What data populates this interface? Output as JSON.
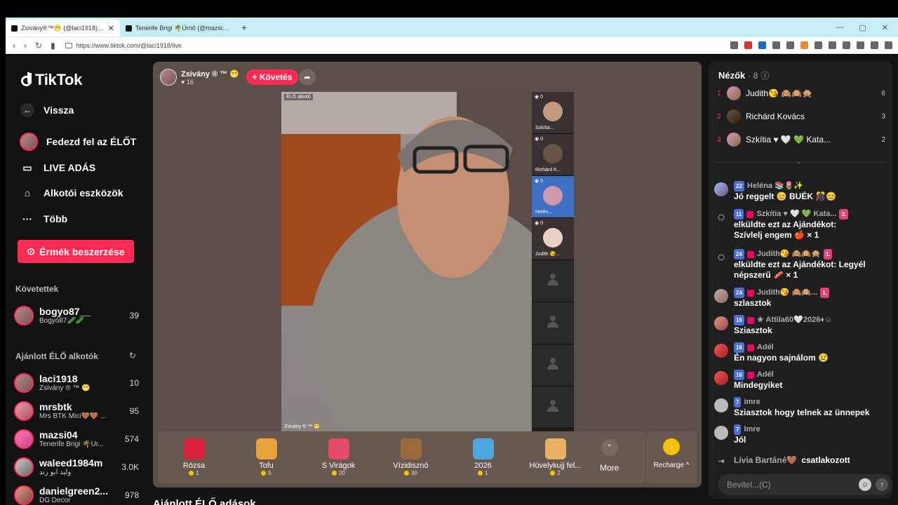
{
  "browser": {
    "tabs": [
      {
        "title": "Zsivány®™😁 (@laci1918) É...",
        "close": "✕"
      },
      {
        "title": "Tenerife Brigi 🌴Úrnő (@mazsi04) Él..."
      }
    ],
    "new_tab": "+",
    "url": "https://www.tiktok.com/@laci1918/live"
  },
  "sidebar": {
    "logo": "TikTok",
    "back": "Vissza",
    "items": [
      "Fedezd fel az ÉLŐT",
      "LIVE ADÁS",
      "Alkotói eszközök",
      "Több"
    ],
    "coins_button": "Érmék beszerzése",
    "following_heading": "Követettek",
    "following": [
      {
        "name": "bogyo87__",
        "sub": "Bogyó87🥒🥒",
        "count": "39"
      }
    ],
    "recommended_heading": "Ajánlott ÉLŐ alkotók",
    "recommended": [
      {
        "name": "laci1918",
        "sub": "Zsivány ® ™ 😁",
        "count": "10"
      },
      {
        "name": "mrsbtk",
        "sub": "Mrs BTK Mici🤎🤎 ...",
        "count": "95"
      },
      {
        "name": "mazsi04",
        "sub": "Tenerife Brigi 🌴Úr...",
        "count": "574"
      },
      {
        "name": "waleed1984m",
        "sub": "وليد ابو رند",
        "count": "3.0K"
      },
      {
        "name": "danielgreen2...",
        "sub": "DG Decor",
        "count": "978"
      }
    ]
  },
  "bottom_heading": "Ajánlott ÉLŐ adások",
  "player": {
    "host_name": "Zsivány ® ™ 😁",
    "likes": "♥ 16",
    "follow": "+ Követés",
    "video_tag": "ÉLŐ alkotó",
    "video_caption": "Zsivány ® ™ 😁",
    "guests": [
      {
        "viewers": "0",
        "name": "Szkítia..."
      },
      {
        "viewers": "0",
        "name": "Richárd K..."
      },
      {
        "viewers": "0",
        "name": "Helén..."
      },
      {
        "viewers": "0",
        "name": "Judith 😘..."
      }
    ],
    "gifts": [
      {
        "name": "Rózsa",
        "cost": "1",
        "color": "#d9243c"
      },
      {
        "name": "Tofu",
        "cost": "5",
        "color": "#e8a23c"
      },
      {
        "name": "S Virágok",
        "cost": "20",
        "color": "#e34a6a"
      },
      {
        "name": "Vízidisznó",
        "cost": "30",
        "color": "#9a6a3c"
      },
      {
        "name": "2026",
        "cost": "1",
        "color": "#4ea8e0"
      },
      {
        "name": "Hüvelykujj fel...",
        "cost": "2",
        "color": "#e8b060"
      }
    ],
    "more": "More",
    "recharge": "Recharge ^"
  },
  "chat": {
    "viewers_heading": "Nézők",
    "viewers_count": "· 8",
    "top_viewers": [
      {
        "rank": "1",
        "name": "Judith😘 🙈🙉🙊",
        "value": "6"
      },
      {
        "rank": "2",
        "name": "Richárd Kovács",
        "value": "3"
      },
      {
        "rank": "3",
        "name": "Szkítia ♥ 🤍 💚 Kata...",
        "value": "2"
      }
    ],
    "messages": [
      {
        "badge": "22",
        "user": "Heléna 📚🌷✨",
        "text": "Jó reggelt 😊 BUÉK 🎊😊"
      },
      {
        "badge": "11",
        "user": "Szkítia ♥ 🤍 💚 Kata...",
        "text": "elküldte ezt az Ajándékot: Szívlelj engem 🍎 × 1",
        "gift": true
      },
      {
        "badge": "24",
        "user": "Judith😘 🙈🙉🙊",
        "text": "elküldte ezt az Ajándékot: Legyél népszerű 🥓 × 1",
        "gift": true
      },
      {
        "badge": "24",
        "user": "Judith😘 🙈🙉...",
        "text": "szlasztok"
      },
      {
        "badge": "16",
        "user": "★ Attila60🤍2026♦☺",
        "text": "Sziasztok"
      },
      {
        "badge": "16",
        "user": "Adél",
        "text": "Én nagyon sajnálom 😢"
      },
      {
        "badge": "16",
        "user": "Adél",
        "text": "Mindegyiket"
      },
      {
        "badge": "7",
        "user": "imre",
        "text": "Sziasztok hogy telnek az ünnepek"
      },
      {
        "badge": "7",
        "user": "Imre",
        "text": "Jól"
      }
    ],
    "join": {
      "name": "Lívia Bartáné🤎",
      "action": "csatlakozott"
    },
    "input_placeholder": "Bevitel...(C)"
  }
}
